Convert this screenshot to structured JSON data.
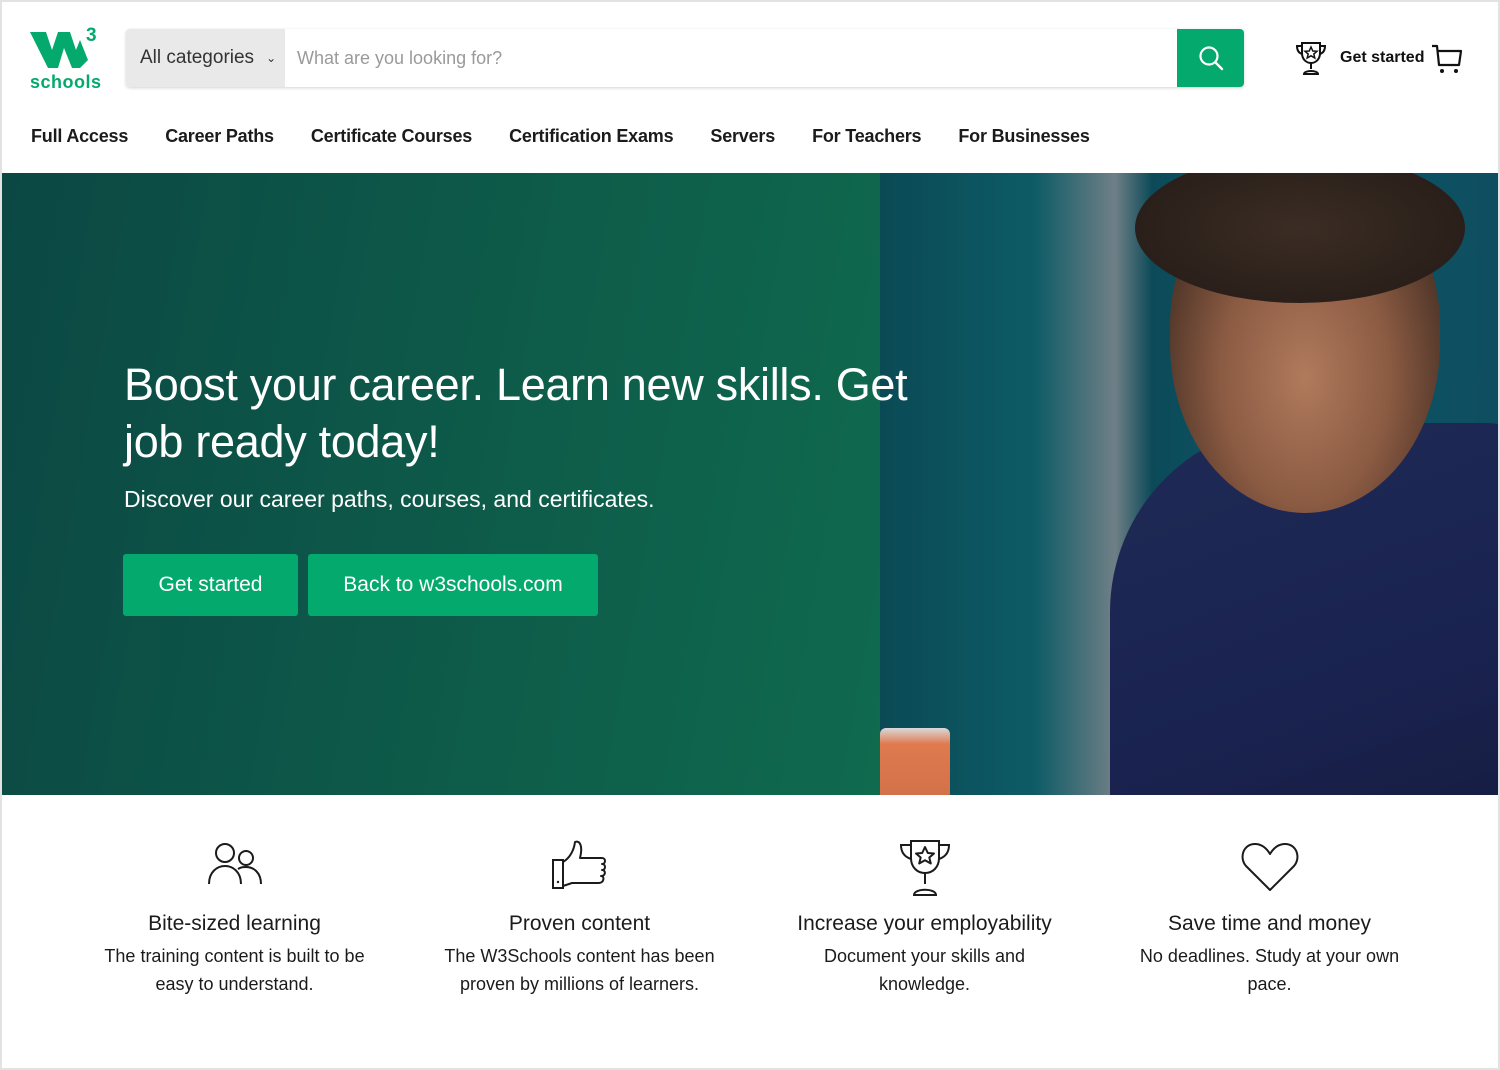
{
  "brand": {
    "name": "w3schools",
    "logo_word": "schools",
    "logo_sup": "3",
    "accent": "#04aa6d"
  },
  "header": {
    "category_select": "All categories",
    "search_placeholder": "What are you looking for?",
    "search_icon": "search-icon",
    "get_started": "Get started",
    "trophy_icon": "trophy-icon",
    "cart_icon": "cart-icon"
  },
  "nav": {
    "items": [
      {
        "label": "Full Access"
      },
      {
        "label": "Career Paths"
      },
      {
        "label": "Certificate Courses"
      },
      {
        "label": "Certification Exams"
      },
      {
        "label": "Servers"
      },
      {
        "label": "For Teachers"
      },
      {
        "label": "For Businesses"
      }
    ]
  },
  "hero": {
    "title": "Boost your career. Learn new skills. Get job ready today!",
    "subtitle": "Discover our career paths, courses, and certificates.",
    "primary_button": "Get started",
    "secondary_button": "Back to w3schools.com",
    "image": "man-looking-at-laptop-photo"
  },
  "features": [
    {
      "icon": "users-icon",
      "title": "Bite-sized learning",
      "text": "The training content is built to be easy to understand."
    },
    {
      "icon": "thumbs-up-icon",
      "title": "Proven content",
      "text": "The W3Schools content has been proven by millions of learners."
    },
    {
      "icon": "trophy-icon",
      "title": "Increase your employability",
      "text": "Document your skills and knowledge."
    },
    {
      "icon": "heart-icon",
      "title": "Save time and money",
      "text": "No deadlines. Study at your own pace."
    }
  ]
}
